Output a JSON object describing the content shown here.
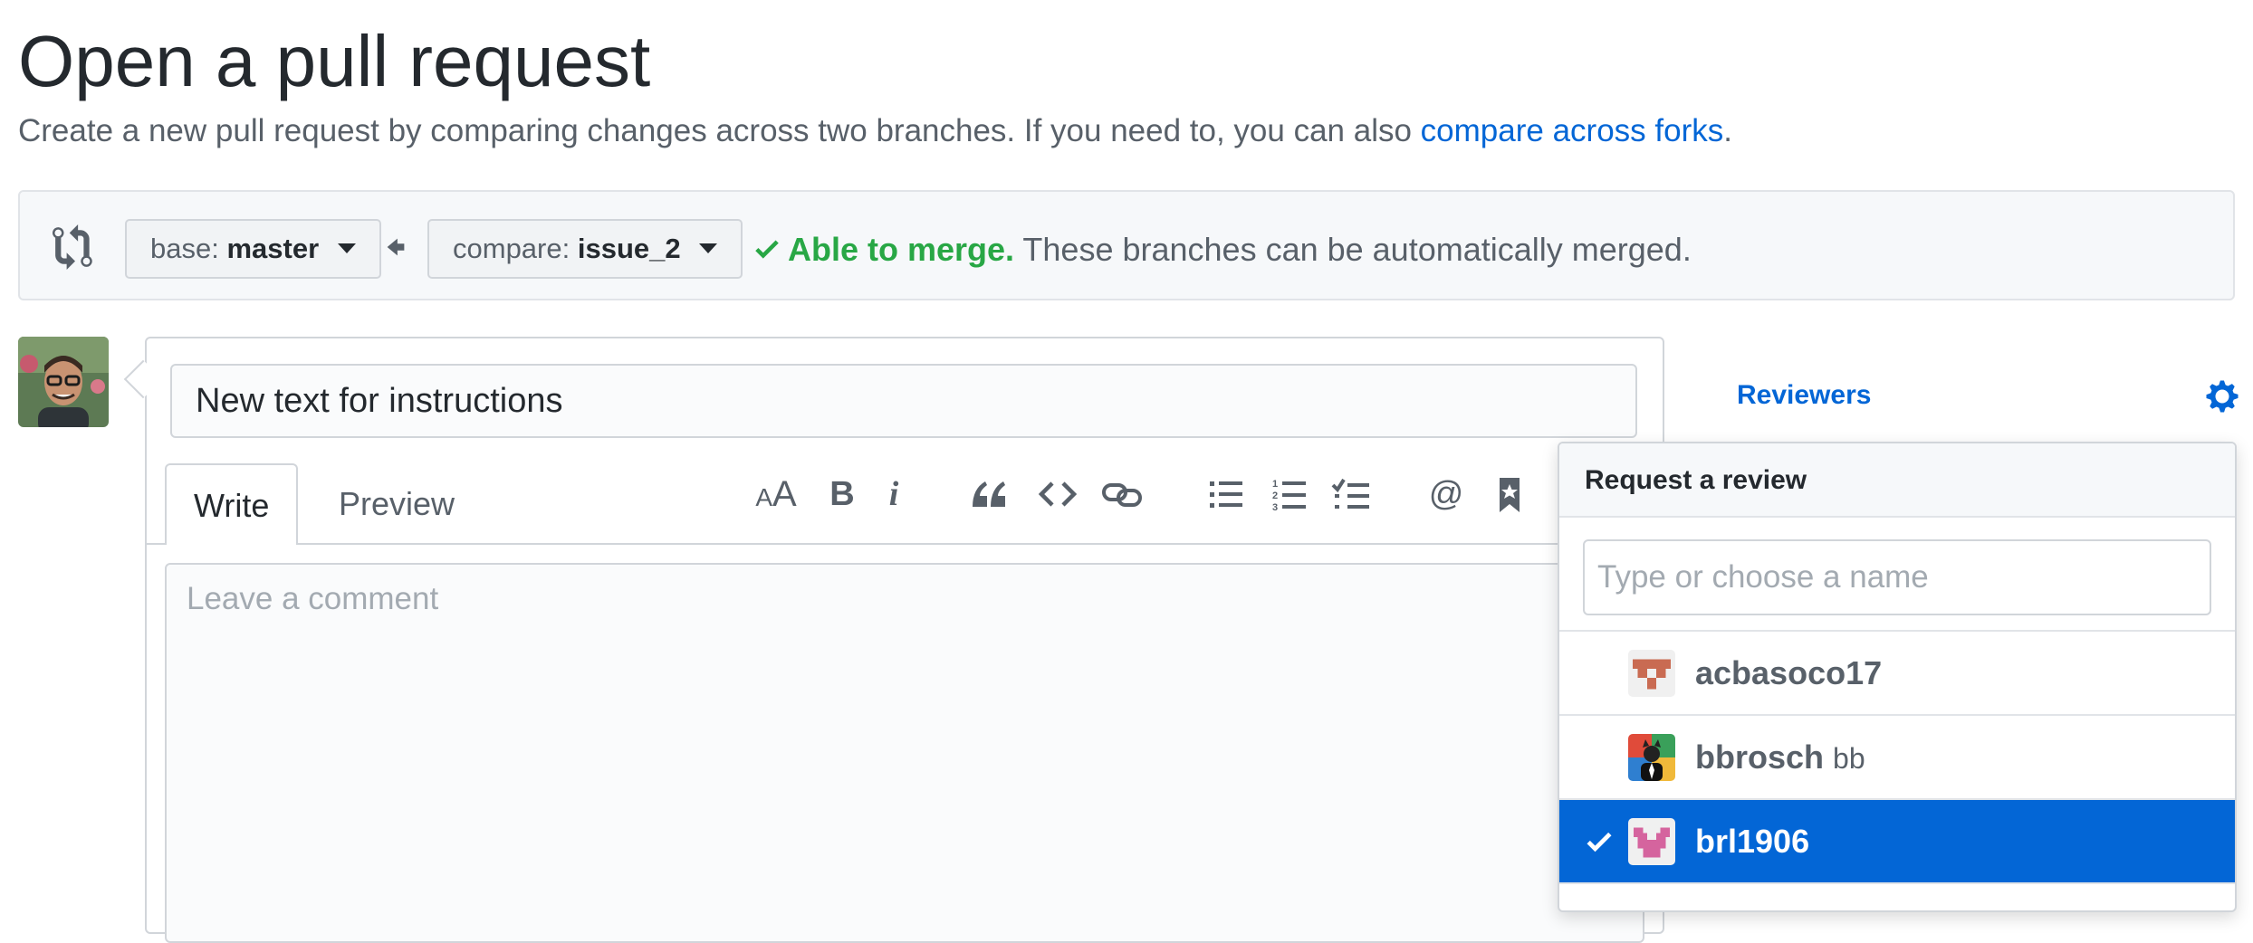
{
  "header": {
    "title": "Open a pull request",
    "subtitle_prefix": "Create a new pull request by comparing changes across two branches. If you need to, you can also ",
    "subtitle_link": "compare across forks",
    "subtitle_suffix": "."
  },
  "range": {
    "base_label": "base:",
    "base_value": "master",
    "compare_label": "compare:",
    "compare_value": "issue_2",
    "merge_ok": "Able to merge.",
    "merge_text": " These branches can be automatically merged."
  },
  "editor": {
    "title_value": "New text for instructions",
    "tabs": [
      "Write",
      "Preview"
    ],
    "comment_placeholder": "Leave a comment"
  },
  "toolbar": {
    "icons": [
      "text-size-icon",
      "bold-icon",
      "italic-icon",
      "quote-icon",
      "code-icon",
      "link-icon",
      "bulleted-list-icon",
      "numbered-list-icon",
      "task-list-icon",
      "mention-icon",
      "saved-reply-icon"
    ]
  },
  "sidebar": {
    "reviewers_heading": "Reviewers"
  },
  "review_menu": {
    "header": "Request a review",
    "filter_placeholder": "Type or choose a name",
    "items": [
      {
        "login": "acbasoco17",
        "name": "",
        "selected": false
      },
      {
        "login": "bbrosch",
        "name": "bb",
        "selected": false
      },
      {
        "login": "brl1906",
        "name": "",
        "selected": true
      }
    ]
  },
  "colors": {
    "link": "#0366d6",
    "merge_ok": "#28a745",
    "selected_bg": "#0366d6"
  }
}
